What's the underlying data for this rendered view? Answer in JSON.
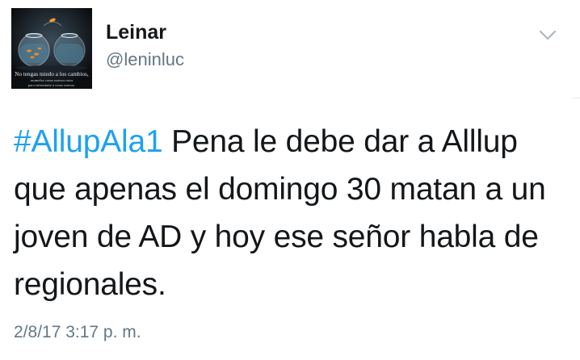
{
  "user": {
    "display_name": "Leinar",
    "handle": "@leninluc",
    "avatar": {
      "caption_line1": "No tengas miedo a los cambios,",
      "caption_line2": "asumelos como nuevos retos",
      "caption_line3": "para enfrentarte a cosas nuevas."
    }
  },
  "tweet": {
    "hashtag": "#AllupAla1",
    "text": " Pena le debe dar a Alllup que apenas el domingo 30 matan a un joven de AD y hoy ese señor habla de regionales.",
    "timestamp": "2/8/17 3:17 p. m."
  },
  "icons": {
    "menu": "chevron-down-icon"
  },
  "colors": {
    "link": "#1da1f2",
    "secondary_text": "#657786",
    "primary_text": "#14171a",
    "background": "#ffffff"
  }
}
